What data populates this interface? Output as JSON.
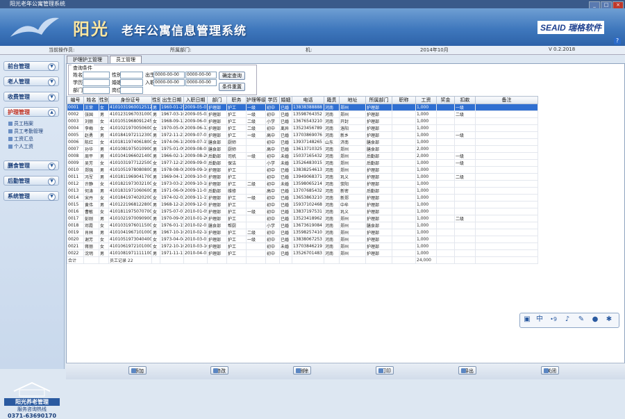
{
  "window": {
    "title": "阳光老年公寓管理系统",
    "controls": [
      "_",
      "□",
      "×"
    ]
  },
  "banner": {
    "logo": "阳光",
    "system_name": "老年公寓信息管理系统",
    "company": "SEAID 瑞格软件",
    "help": "?"
  },
  "statusbar": {
    "user": "当前操作员:",
    "dept": "所属部门:",
    "host": "机:",
    "date": "2014年10月",
    "version": "V 0.2.2018"
  },
  "sidebar": {
    "items": [
      {
        "label": "前台管理"
      },
      {
        "label": "老人管理"
      },
      {
        "label": "收费管理"
      },
      {
        "label": "护理管理"
      },
      {
        "label": "膳食管理"
      },
      {
        "label": "后勤管理"
      },
      {
        "label": "系统管理"
      }
    ],
    "subitems": [
      "员工档案",
      "员工考勤管理",
      "工资汇总",
      "个人工资"
    ],
    "brand_name": "阳光养老管理",
    "hotline": "服务咨询热线",
    "phone": "0371-63690170"
  },
  "tabs": [
    {
      "label": "护理护工管理"
    },
    {
      "label": "员工管理"
    }
  ],
  "filter": {
    "legend": "查询条件",
    "name_label": "姓名",
    "sex_label": "性别",
    "birth_label": "出生",
    "birth_from": "0000-00-00",
    "birth_to": "0000-00-00",
    "edu_label": "学历",
    "marry_label": "婚姻",
    "entry_label": "入职",
    "entry_from": "0000-00-00",
    "entry_to": "0000-00-00",
    "dept_label": "部门",
    "post_label": "岗位",
    "query_button": "确定查询",
    "reset_button": "条件重置"
  },
  "table": {
    "headers": [
      "编号",
      "姓名",
      "性别",
      "身份证号",
      "性别",
      "出生日期",
      "入职日期",
      "部门",
      "职务",
      "护理等级",
      "学历",
      "婚姻",
      "电话",
      "籍贯",
      "地址",
      "所属部门",
      "职称",
      "工资",
      "奖金",
      "扣款",
      "备注"
    ],
    "rows": [
      [
        "0001",
        "王荣",
        "女",
        "410103196001251234",
        "男",
        "1960-01-25",
        "2009-05-01",
        "护理部",
        "护工",
        "一级",
        "初中",
        "已婚",
        "13838388888",
        "河南",
        "郑州",
        "护理部",
        "",
        "1,000",
        "",
        "一级",
        ""
      ],
      [
        "0002",
        "张国",
        "男",
        "410123196703100011",
        "男",
        "1967-03-10",
        "2009-05-03",
        "护理部",
        "护工",
        "一级",
        "初中",
        "已婚",
        "13598764352",
        "河南",
        "郑州",
        "护理部",
        "",
        "1,000",
        "",
        "二级",
        ""
      ],
      [
        "0003",
        "刘丽",
        "女",
        "410105196809124567",
        "女",
        "1968-09-12",
        "2009-06-01",
        "护理部",
        "护工",
        "二级",
        "小学",
        "已婚",
        "13676543210",
        "河南",
        "开封",
        "护理部",
        "",
        "1,000",
        "",
        "",
        ""
      ],
      [
        "0004",
        "李梅",
        "女",
        "410102197005060022",
        "女",
        "1970-05-06",
        "2009-06-12",
        "护理部",
        "护工",
        "二级",
        "初中",
        "离异",
        "13523456789",
        "河南",
        "洛阳",
        "护理部",
        "",
        "1,000",
        "",
        "",
        ""
      ],
      [
        "0005",
        "赵勇",
        "男",
        "410184197211230013",
        "男",
        "1972-11-23",
        "2009-07-01",
        "护理部",
        "护工",
        "一级",
        "高中",
        "已婚",
        "13703869076",
        "河南",
        "新乡",
        "护理部",
        "",
        "1,000",
        "",
        "一级",
        ""
      ],
      [
        "0006",
        "陈红",
        "女",
        "410181197406180028",
        "女",
        "1974-06-18",
        "2009-07-15",
        "膳食部",
        "厨师",
        "",
        "初中",
        "已婚",
        "13937148265",
        "山东",
        "济南",
        "膳食部",
        "",
        "1,000",
        "",
        "",
        ""
      ],
      [
        "0007",
        "孙华",
        "男",
        "410108197501090031",
        "男",
        "1975-01-09",
        "2009-08-01",
        "膳食部",
        "厨师",
        "",
        "高中",
        "已婚",
        "13613710325",
        "河南",
        "郑州",
        "膳食部",
        "",
        "2,000",
        "",
        "",
        ""
      ],
      [
        "0008",
        "周平",
        "男",
        "410104196602140013",
        "男",
        "1966-02-14",
        "2009-08-20",
        "后勤部",
        "司机",
        "一级",
        "初中",
        "未婚",
        "15037165432",
        "河南",
        "郑州",
        "后勤部",
        "",
        "2,000",
        "",
        "一级",
        ""
      ],
      [
        "0009",
        "吴芳",
        "女",
        "410103197712250046",
        "女",
        "1977-12-25",
        "2009-09-01",
        "后勤部",
        "保洁",
        "",
        "小学",
        "未婚",
        "13526483015",
        "河南",
        "郑州",
        "后勤部",
        "",
        "1,000",
        "",
        "一级",
        ""
      ],
      [
        "0010",
        "郑强",
        "男",
        "410105197808080057",
        "男",
        "1978-08-08",
        "2009-09-10",
        "护理部",
        "护工",
        "",
        "初中",
        "已婚",
        "13838254613",
        "河南",
        "郑州",
        "护理部",
        "",
        "1,000",
        "",
        "",
        ""
      ],
      [
        "0011",
        "冯军",
        "男",
        "410181196904170018",
        "男",
        "1969-04-17",
        "2009-10-01",
        "护理部",
        "护工",
        "",
        "初中",
        "已婚",
        "13949068371",
        "河南",
        "巩义",
        "护理部",
        "",
        "1,000",
        "",
        "二级",
        ""
      ],
      [
        "0012",
        "许静",
        "女",
        "410182197303210027",
        "女",
        "1973-03-21",
        "2009-10-18",
        "护理部",
        "护工",
        "二级",
        "初中",
        "未婚",
        "13598065214",
        "河南",
        "荥阳",
        "护理部",
        "",
        "1,000",
        "",
        "",
        ""
      ],
      [
        "0013",
        "何涛",
        "男",
        "410183197106060031",
        "男",
        "1971-06-06",
        "2009-11-01",
        "后勤部",
        "维修",
        "",
        "高中",
        "已婚",
        "13707685432",
        "河南",
        "新密",
        "后勤部",
        "",
        "1,000",
        "",
        "",
        ""
      ],
      [
        "0014",
        "宋丹",
        "女",
        "410184197402020040",
        "女",
        "1974-02-02",
        "2009-11-15",
        "护理部",
        "护工",
        "一级",
        "初中",
        "已婚",
        "13653863210",
        "河南",
        "新郑",
        "护理部",
        "",
        "1,000",
        "",
        "",
        ""
      ],
      [
        "0015",
        "黄伟",
        "男",
        "410122196812280015",
        "男",
        "1968-12-28",
        "2009-12-01",
        "护理部",
        "护工",
        "",
        "初中",
        "已婚",
        "15937102468",
        "河南",
        "中牟",
        "护理部",
        "",
        "1,000",
        "",
        "",
        ""
      ],
      [
        "0016",
        "曹敏",
        "女",
        "410181197507070062",
        "女",
        "1975-07-07",
        "2010-01-05",
        "护理部",
        "护工",
        "一级",
        "初中",
        "已婚",
        "13837197531",
        "河南",
        "巩义",
        "护理部",
        "",
        "1,000",
        "",
        "",
        ""
      ],
      [
        "0017",
        "彭刚",
        "男",
        "410102197009090033",
        "男",
        "1970-09-09",
        "2010-01-20",
        "护理部",
        "护工",
        "",
        "初中",
        "已婚",
        "13523418962",
        "河南",
        "郑州",
        "护理部",
        "",
        "1,000",
        "",
        "二级",
        ""
      ],
      [
        "0018",
        "邓霞",
        "女",
        "410103197601150048",
        "女",
        "1976-01-15",
        "2010-02-01",
        "膳食部",
        "帮厨",
        "",
        "小学",
        "已婚",
        "13673619084",
        "河南",
        "郑州",
        "膳食部",
        "",
        "1,000",
        "",
        "",
        ""
      ],
      [
        "0019",
        "肖林",
        "男",
        "410104196710100053",
        "男",
        "1967-10-10",
        "2010-02-18",
        "护理部",
        "护工",
        "二级",
        "初中",
        "已婚",
        "13598257410",
        "河南",
        "郑州",
        "护理部",
        "",
        "1,000",
        "",
        "",
        ""
      ],
      [
        "0020",
        "谢芳",
        "女",
        "410105197304040024",
        "女",
        "1973-04-04",
        "2010-03-01",
        "护理部",
        "护工",
        "一级",
        "初中",
        "已婚",
        "13838067253",
        "河南",
        "郑州",
        "护理部",
        "",
        "1,000",
        "",
        "",
        ""
      ],
      [
        "0021",
        "蒋丽",
        "女",
        "410106197210100026",
        "女",
        "1972-10-10",
        "2010-03-16",
        "护理部",
        "护工",
        "",
        "初中",
        "未婚",
        "13703846219",
        "河南",
        "郑州",
        "护理部",
        "",
        "1,000",
        "",
        "",
        ""
      ],
      [
        "0022",
        "沈明",
        "男",
        "410108197111110019",
        "男",
        "1971-11-11",
        "2010-04-01",
        "护理部",
        "护工",
        "",
        "初中",
        "已婚",
        "13526701483",
        "河南",
        "郑州",
        "护理部",
        "",
        "1,000",
        "",
        "",
        ""
      ]
    ],
    "total_label": "合计",
    "total_count": "员工记录 22",
    "total_salary": "24,000"
  },
  "toolbox": {
    "icons": [
      "calendar-icon",
      "chinese-icon",
      "link-icon",
      "mic-icon",
      "edit-icon",
      "user-icon",
      "settings-icon"
    ],
    "chinese": "中",
    "link": "•9"
  },
  "footer": {
    "buttons": [
      "添加",
      "修改",
      "删除",
      "打印",
      "导出",
      "关闭"
    ]
  }
}
